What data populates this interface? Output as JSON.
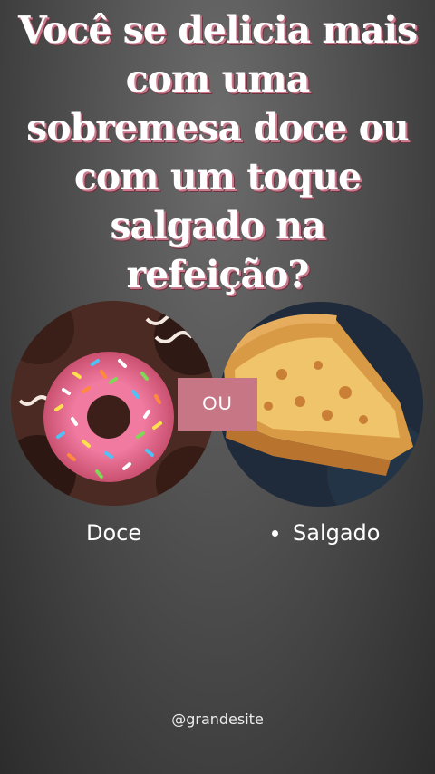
{
  "question": {
    "lines": [
      "Você se delicia mais",
      "com uma",
      "sobremesa doce ou",
      "com um toque",
      "salgado na",
      "refeição?"
    ]
  },
  "images": {
    "left": "donut with colorful sprinkles",
    "right": "slice of quiche"
  },
  "separator": "OU",
  "options": [
    {
      "label": "Doce"
    },
    {
      "label": "Salgado"
    }
  ],
  "footer": {
    "handle": "@grandesite"
  },
  "colors": {
    "accent": "#c77686",
    "title_shadow": "#c97a8c",
    "background": "#4a4a4a"
  }
}
